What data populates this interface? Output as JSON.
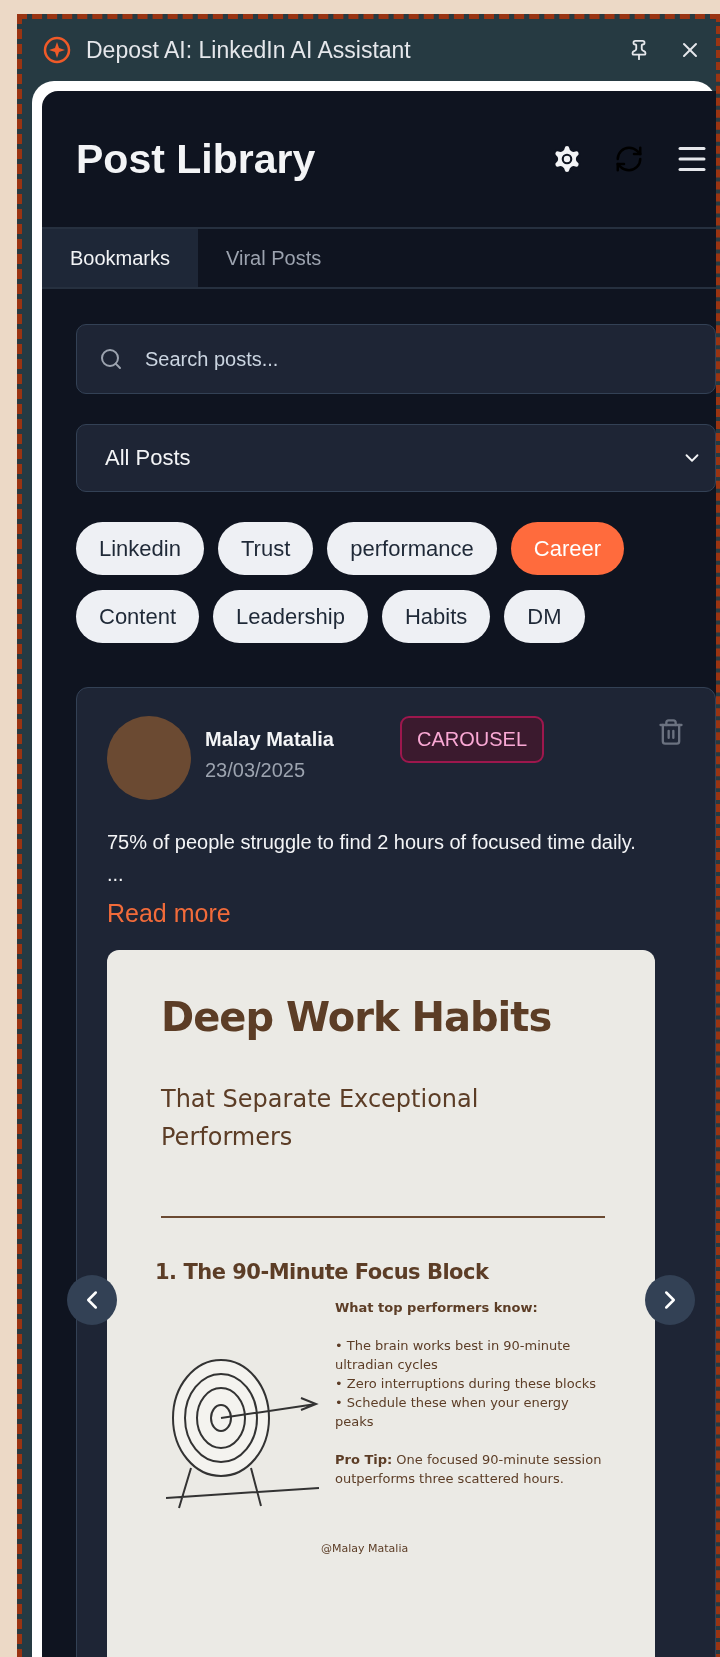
{
  "window": {
    "title": "Depost AI: LinkedIn AI Assistant"
  },
  "header": {
    "title": "Post Library"
  },
  "tabs": [
    {
      "label": "Bookmarks",
      "selected": true
    },
    {
      "label": "Viral Posts",
      "selected": false
    }
  ],
  "search": {
    "placeholder": "Search posts..."
  },
  "filter": {
    "value": "All Posts"
  },
  "tags": [
    {
      "label": "Linkedin",
      "selected": false
    },
    {
      "label": "Trust",
      "selected": false
    },
    {
      "label": "performance",
      "selected": false
    },
    {
      "label": "Career",
      "selected": true
    },
    {
      "label": "Content",
      "selected": false
    },
    {
      "label": "Leadership",
      "selected": false
    },
    {
      "label": "Habits",
      "selected": false
    },
    {
      "label": "DM",
      "selected": false
    }
  ],
  "posts": [
    {
      "author": "Malay Matalia",
      "date": "23/03/2025",
      "type": "CAROUSEL",
      "text": "75% of people struggle to find 2 hours of focused time daily.",
      "ellipsis": "...",
      "read_more": "Read more",
      "slide": {
        "title": "Deep Work Habits",
        "subtitle": "That Separate Exceptional Performers",
        "heading": "1. The 90-Minute Focus Block",
        "list_title": "What top performers know:",
        "bullets": [
          "• The brain works best in 90-minute ultradian cycles",
          "• Zero interruptions during these blocks",
          "• Schedule these when your energy peaks"
        ],
        "tip": "**Pro Tip:** One focused 90-minute session outperforms three scattered hours.",
        "handle": "@Malay Matalia"
      }
    }
  ]
}
